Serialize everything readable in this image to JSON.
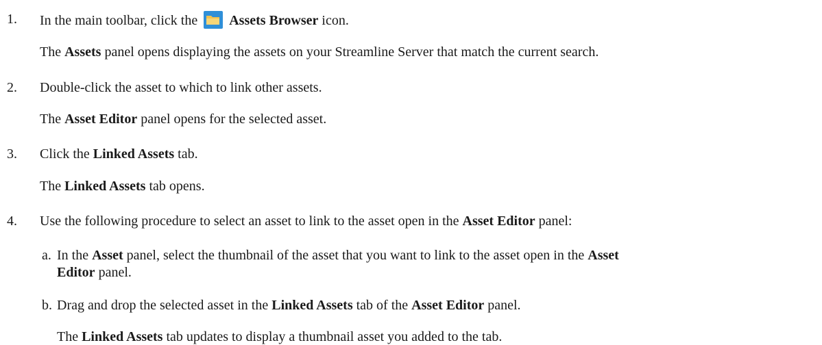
{
  "steps": [
    {
      "num": "1.",
      "parts": [
        "In the main toolbar, click the",
        "Assets Browser",
        "icon."
      ],
      "result": [
        "The",
        "Assets",
        "panel opens displaying the assets on your Streamline Server that match the current search."
      ]
    },
    {
      "num": "2.",
      "parts": [
        "Double-click the asset to which to link other assets."
      ],
      "result": [
        "The",
        "Asset Editor",
        "panel opens for the selected asset."
      ]
    },
    {
      "num": "3.",
      "parts": [
        "Click the",
        "Linked Assets",
        "tab."
      ],
      "result": [
        "The",
        "Linked Assets",
        "tab opens."
      ]
    },
    {
      "num": "4.",
      "parts": [
        "Use the following procedure to select an asset to link to the asset open in the",
        "Asset Editor",
        "panel:"
      ]
    }
  ],
  "substeps": [
    {
      "num": "a.",
      "line1": [
        "In the",
        "Asset",
        "panel, select the thumbnail of the asset that you want to link to the asset open in the",
        "Asset"
      ],
      "line2": [
        "Editor",
        "panel."
      ]
    },
    {
      "num": "b.",
      "parts": [
        "Drag and drop the selected asset in the",
        "Linked Assets",
        "tab of the",
        "Asset Editor",
        "panel."
      ],
      "result": [
        "The",
        "Linked Assets",
        "tab updates to display a thumbnail asset you added to the tab."
      ]
    }
  ],
  "icons": {
    "toolbar_icon": "folder-icon",
    "icon_color": "#2f8fd8",
    "folder_color": "#f2c14e"
  }
}
